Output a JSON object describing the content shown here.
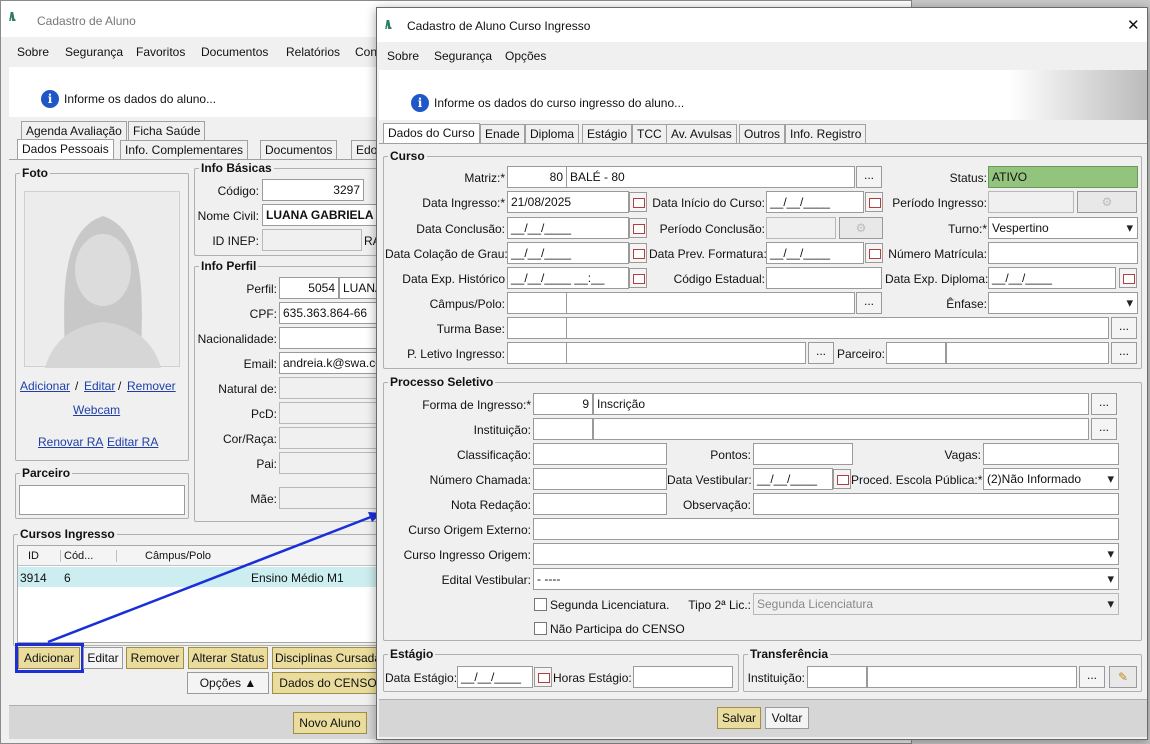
{
  "back": {
    "title": "Cadastro de Aluno",
    "menu": [
      "Sobre",
      "Segurança",
      "Favoritos",
      "Documentos",
      "Relatórios",
      "Con"
    ],
    "info": "Informe os dados do aluno...",
    "tabs_top": [
      "Agenda Avaliação",
      "Ficha Saúde"
    ],
    "tabs": [
      "Dados Pessoais",
      "Info. Complementares",
      "Documentos",
      "Edoc"
    ],
    "foto": "Foto",
    "adicionar": "Adicionar",
    "sep1": "/",
    "editar": "Editar",
    "sep2": "/",
    "remover": "Remover",
    "webcam": "Webcam",
    "renovar_ra": "Renovar RA",
    "editar_ra": "Editar RA",
    "parceiro": "Parceiro",
    "info_basicas": "Info Básicas",
    "codigo_label": "Código:",
    "codigo": "3297",
    "nome_label": "Nome Civil:",
    "nome": "LUANA GABRIELA",
    "inep_label": "ID INEP:",
    "ra_label": "RA",
    "info_perfil": "Info Perfil",
    "perfil_label": "Perfil:",
    "perfil": "5054",
    "perfil_nome": "LUANA",
    "cpf_label": "CPF:",
    "cpf": "635.363.864-66",
    "nac_label": "Nacionalidade:",
    "email_label": "Email:",
    "email": "andreia.k@swa.co",
    "natural_label": "Natural de:",
    "pcd_label": "PcD:",
    "cor_label": "Cor/Raça:",
    "pai_label": "Pai:",
    "mae_label": "Mãe:",
    "cursos": "Cursos Ingresso",
    "cols": [
      "ID",
      "Cód...",
      "Câmpus/Polo"
    ],
    "row": {
      "id": "3914",
      "cod": "6",
      "campus": "",
      "curso": "Ensino Médio M1"
    },
    "buttons": {
      "adicionar": "Adicionar",
      "editar": "Editar",
      "remover": "Remover",
      "alterar": "Alterar Status",
      "disciplinas": "Disciplinas Cursada",
      "opcoes": "Opções ▲",
      "censo": "Dados do CENSO",
      "novo": "Novo Aluno"
    }
  },
  "dlg": {
    "title": "Cadastro de Aluno Curso Ingresso",
    "close": "✕",
    "menu": [
      "Sobre",
      "Segurança",
      "Opções"
    ],
    "info": "Informe os dados do curso ingresso do aluno...",
    "tabs": [
      "Dados do Curso",
      "Enade",
      "Diploma",
      "Estágio",
      "TCC",
      "Av. Avulsas",
      "Outros",
      "Info. Registro"
    ],
    "curso": "Curso",
    "matriz_label": "Matriz:*",
    "matriz_cod": "80",
    "matriz": "BALÉ - 80",
    "status_label": "Status:",
    "status": "ATIVO",
    "data_ing_label": "Data Ingresso:*",
    "data_ing": "21/08/2025",
    "data_ini_label": "Data Início do Curso:",
    "date_empty": "__/__/____",
    "periodo_ing_label": "Período Ingresso:",
    "data_conc_label": "Data Conclusão:",
    "periodo_conc_label": "Período Conclusão:",
    "turno_label": "Turno:*",
    "turno": "Vespertino",
    "data_col_label": "Data Colação de Grau:",
    "data_prev_label": "Data Prev. Formatura:",
    "num_mat_label": "Número Matrícula:",
    "data_exp_hist_label": "Data Exp. Histórico",
    "data_exp_hist": "__/__/____ __:__",
    "cod_est_label": "Código Estadual:",
    "data_exp_dip_label": "Data Exp. Diploma:",
    "campus_label": "Câmpus/Polo:",
    "enfase_label": "Ênfase:",
    "turma_label": "Turma Base:",
    "pletivo_label": "P. Letivo Ingresso:",
    "parceiro_label": "Parceiro:",
    "processo": "Processo Seletivo",
    "forma_label": "Forma de Ingresso:*",
    "forma_cod": "9",
    "forma": "Inscrição",
    "inst_label": "Instituição:",
    "class_label": "Classificação:",
    "pontos_label": "Pontos:",
    "vagas_label": "Vagas:",
    "num_cham_label": "Número Chamada:",
    "data_vest_label": "Data Vestibular:",
    "proced_label": "Proced. Escola Pública:*",
    "proced": "(2)Não Informado",
    "nota_label": "Nota Redação:",
    "obs_label": "Observação:",
    "origem_ext_label": "Curso Origem Externo:",
    "origem_ing_label": "Curso Ingresso Origem:",
    "edital_label": "Edital Vestibular:",
    "edital": "- ----",
    "seg_lic": "Segunda Licenciatura.",
    "tipo2_label": "Tipo 2ª Lic.:",
    "tipo2": "Segunda Licenciatura",
    "nao_censo": "Não Participa do CENSO",
    "estagio": "Estágio",
    "data_est_label": "Data Estágio:",
    "horas_label": "Horas Estágio:",
    "transf": "Transferência",
    "transf_inst_label": "Instituição:",
    "salvar": "Salvar",
    "voltar": "Voltar",
    "dots": "..."
  },
  "colors": {
    "accent": "#1a2fd8",
    "status_bg": "#93c47d",
    "selected_row": "#cdeef0"
  }
}
